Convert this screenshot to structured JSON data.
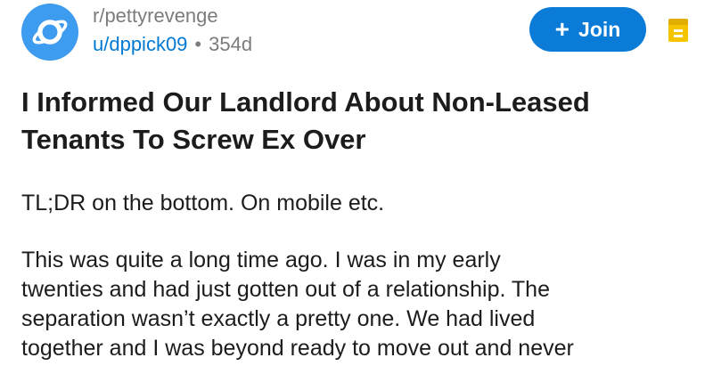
{
  "post": {
    "subreddit": "r/pettyrevenge",
    "username": "u/dppick09",
    "separator": "•",
    "age": "354d",
    "join_label": "Join",
    "join_icon": "plus-icon",
    "title": "I Informed Our Landlord About Non-Leased Tenants To Screw Ex Over",
    "tldr": "TL;DR on the bottom. On mobile etc.",
    "body_lines": [
      "This was quite a long time ago. I was in my early",
      "twenties and had just gotten out of a relationship. The",
      "separation wasn’t exactly a pretty one. We had lived",
      "together and I was beyond ready to move out and never"
    ]
  },
  "colors": {
    "accent": "#0a7bd6",
    "username": "#0079d3",
    "avatar": "#3d9bf0",
    "save_icon": "#f5c400"
  },
  "icons": {
    "avatar": "planet-icon",
    "save": "save-icon"
  }
}
